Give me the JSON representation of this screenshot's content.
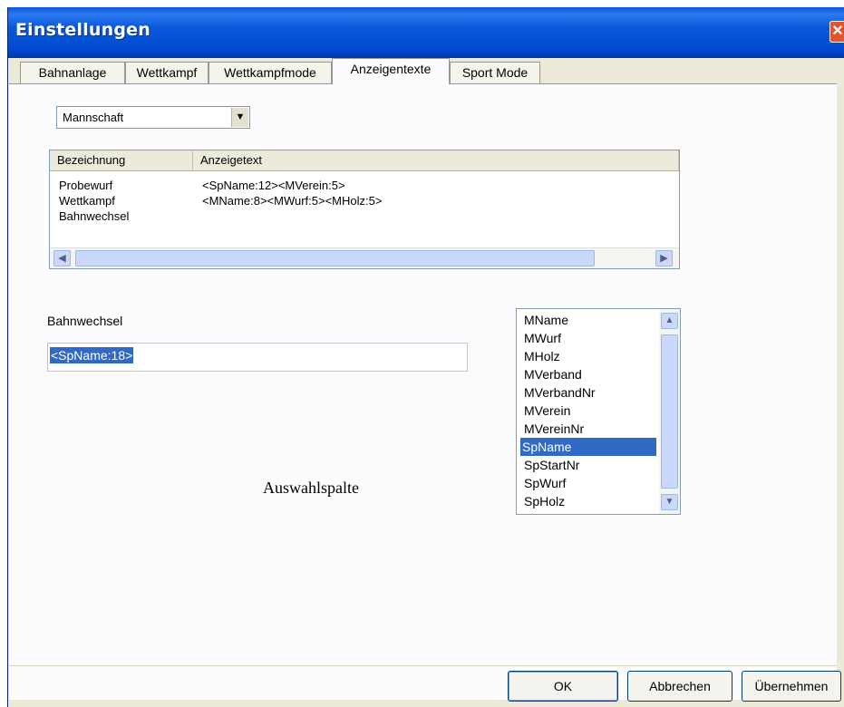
{
  "window": {
    "title": "Einstellungen",
    "close_symbol": "✕"
  },
  "tabs": [
    {
      "label": "Bahnanlage",
      "active": false
    },
    {
      "label": "Wettkampf",
      "active": false
    },
    {
      "label": "Wettkampfmode",
      "active": false
    },
    {
      "label": "Anzeigentexte",
      "active": true
    },
    {
      "label": "Sport Mode",
      "active": false
    }
  ],
  "combo": {
    "value": "Mannschaft",
    "arrow": "▼"
  },
  "table": {
    "columns": [
      "Bezeichnung",
      "Anzeigetext"
    ],
    "rows": [
      {
        "name": "Probewurf",
        "text": "<SpName:12><MVerein:5>"
      },
      {
        "name": "Wettkampf",
        "text": "<MName:8><MWurf:5><MHolz:5>"
      },
      {
        "name": "Bahnwechsel",
        "text": ""
      }
    ],
    "scroll_left": "◀",
    "scroll_right": "▶"
  },
  "editor": {
    "label": "Bahnwechsel",
    "value": "<SpName:18>"
  },
  "caption": "Auswahlspalte",
  "listbox": {
    "items": [
      "MName",
      "MWurf",
      "MHolz",
      "MVerband",
      "MVerbandNr",
      "MVerein",
      "MVereinNr",
      "SpName",
      "SpStartNr",
      "SpWurf",
      "SpHolz"
    ],
    "selected": "SpName",
    "scroll_up": "▲",
    "scroll_down": "▼"
  },
  "buttons": {
    "ok": "OK",
    "cancel": "Abbrechen",
    "apply": "Übernehmen"
  },
  "colors": {
    "titlebar": "#0a58d8",
    "selection": "#316ac5",
    "dialog_bg": "#ece9d8",
    "close": "#e2542f"
  }
}
